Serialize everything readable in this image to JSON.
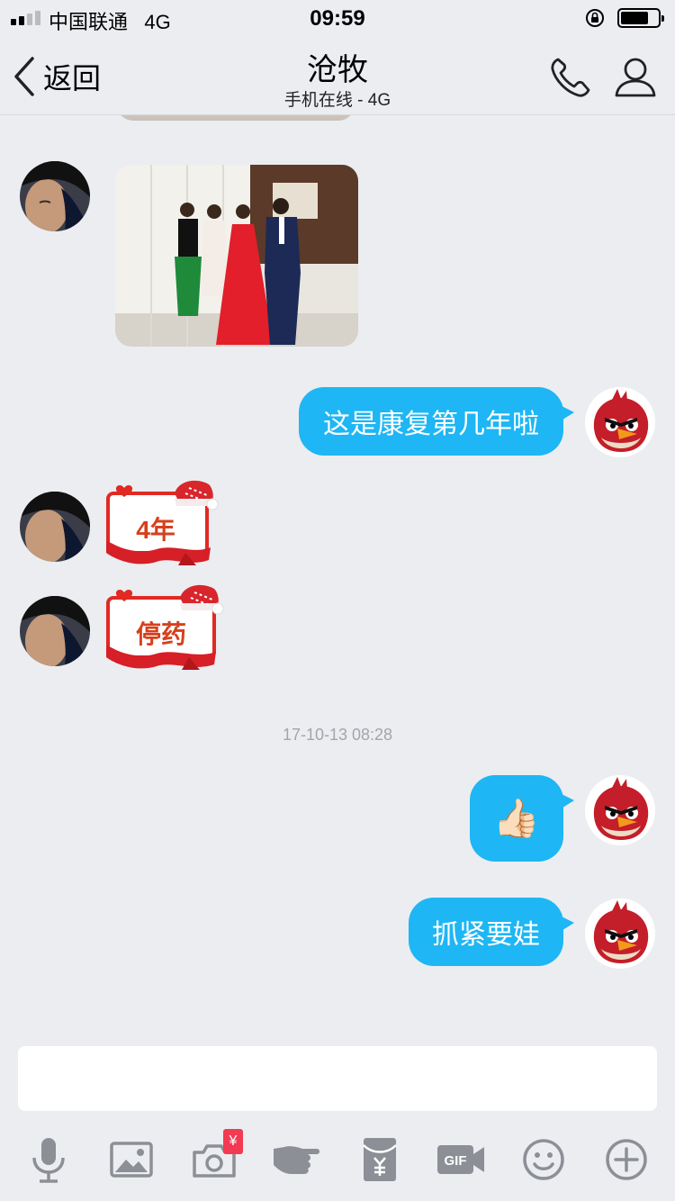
{
  "status_bar": {
    "carrier": "中国联通",
    "network": "4G",
    "time": "09:59",
    "signal_bars": 4,
    "signal_strength": 2,
    "battery_level": 0.75
  },
  "nav": {
    "back_label": "返回",
    "title": "沧牧",
    "subtitle": "手机在线 - 4G",
    "icons": [
      "phone-icon",
      "profile-icon"
    ]
  },
  "messages": [
    {
      "side": "left",
      "type": "image"
    },
    {
      "side": "right",
      "type": "text",
      "text": "这是康复第几年啦"
    },
    {
      "side": "left",
      "type": "sticker",
      "text": "4年"
    },
    {
      "side": "left",
      "type": "sticker",
      "text": "停药"
    },
    {
      "type": "timestamp",
      "text": "17-10-13 08:28"
    },
    {
      "side": "right",
      "type": "emoji",
      "emoji": "👍🏻"
    },
    {
      "side": "right",
      "type": "text",
      "text": "抓紧要娃"
    }
  ],
  "toolbar": {
    "items": [
      "microphone-icon",
      "image-icon",
      "camera-icon",
      "poke-icon",
      "red-envelope-icon",
      "gif-icon",
      "emoji-icon",
      "plus-icon"
    ],
    "camera_badge": "¥"
  },
  "colors": {
    "background": "#ebedf1",
    "bubble": "#1eb6f4",
    "icon_gray": "#8c8f96",
    "badge_red": "#f23a53"
  }
}
